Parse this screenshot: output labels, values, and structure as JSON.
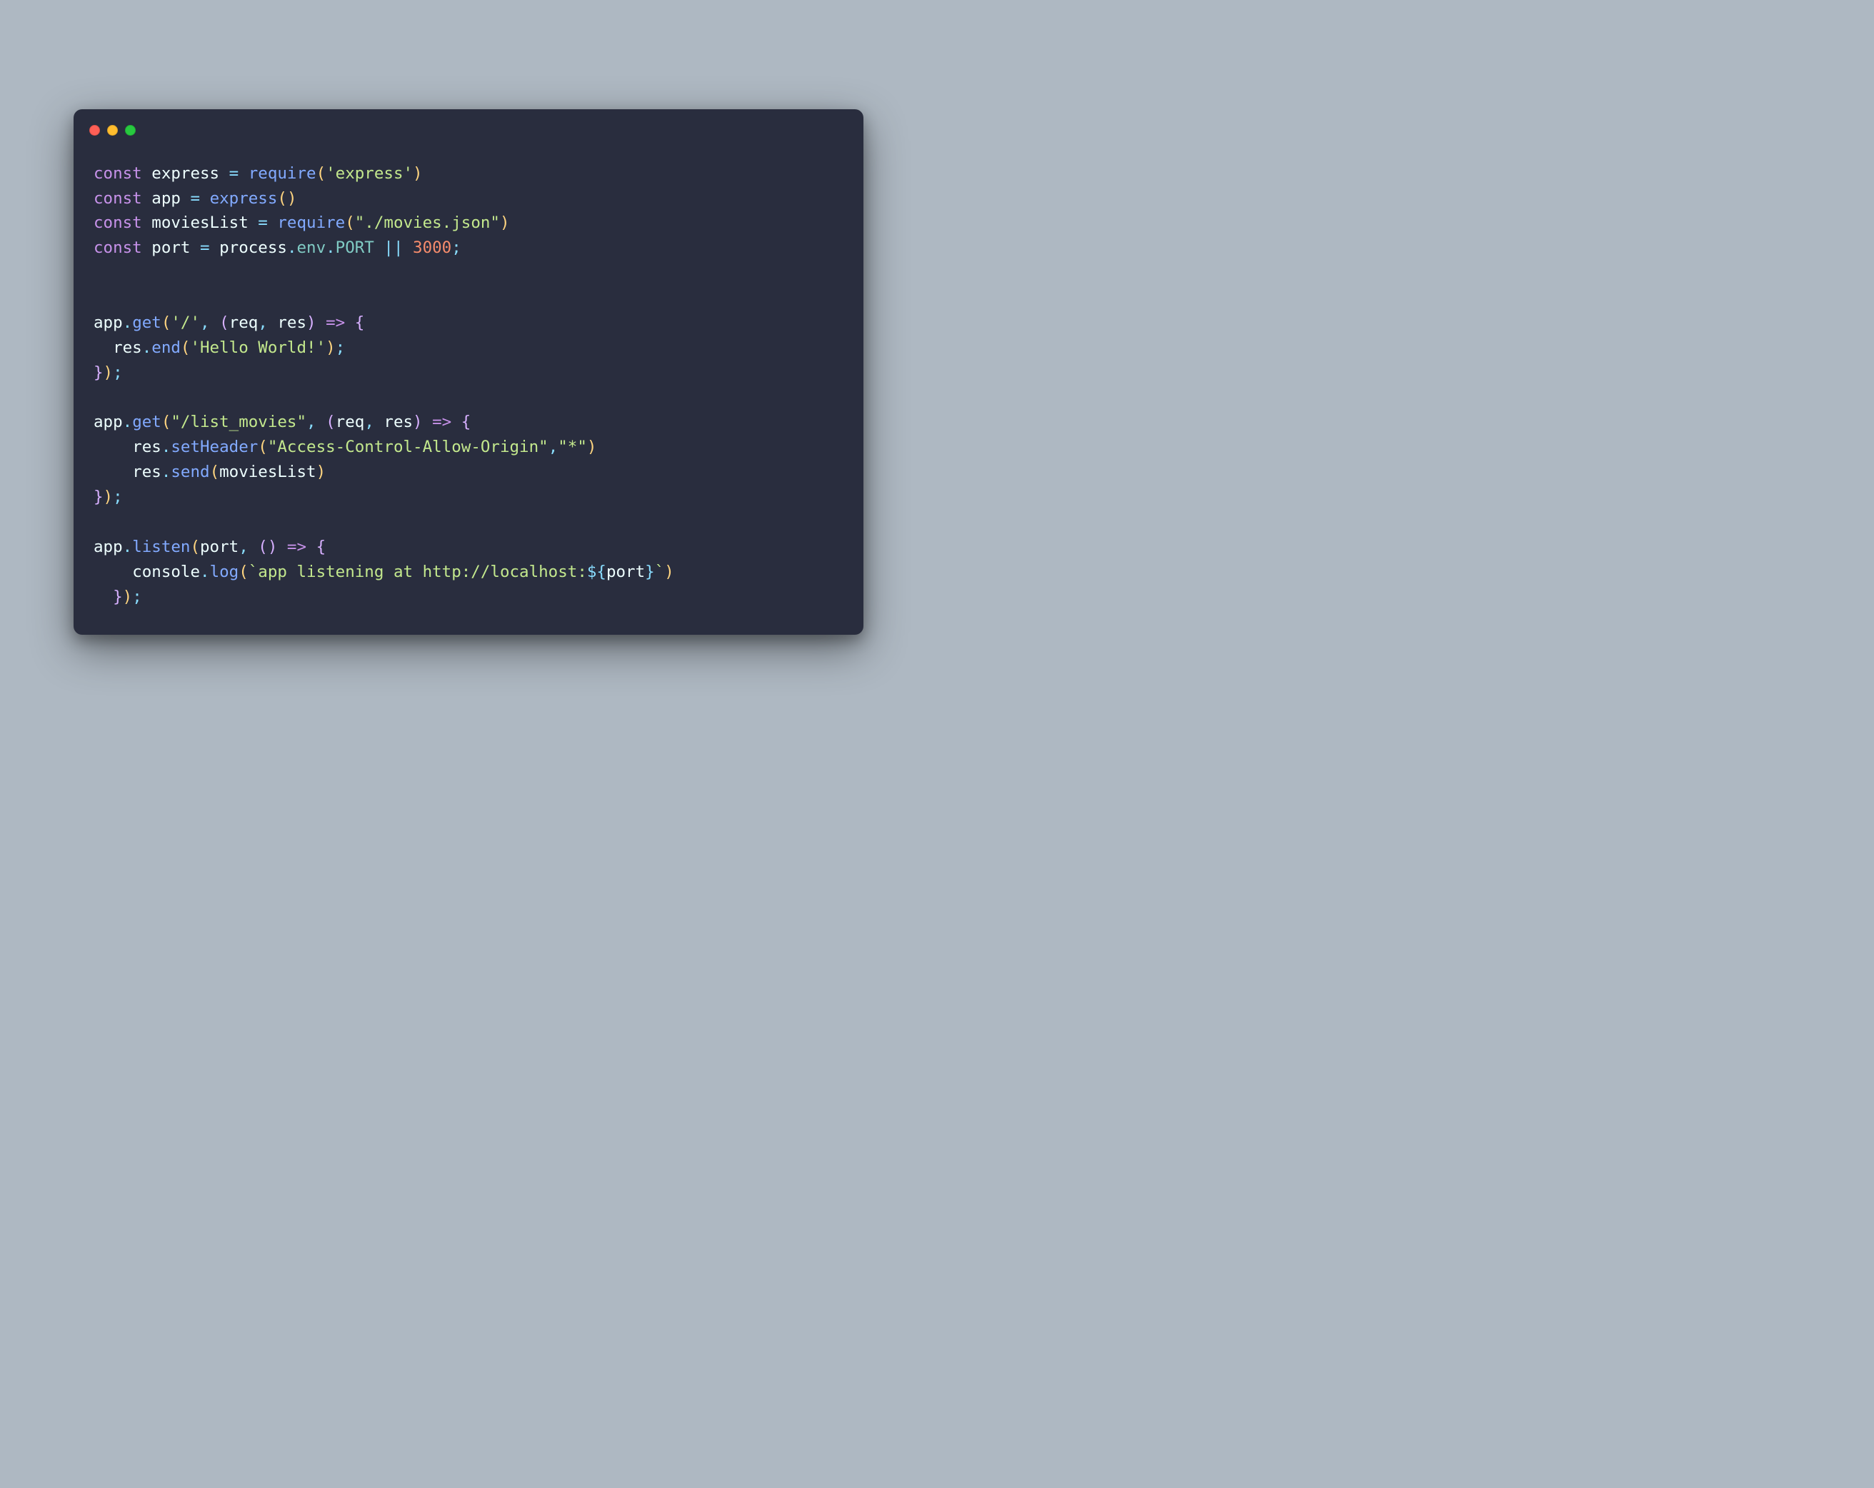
{
  "window": {
    "traffic_lights": [
      "close",
      "minimize",
      "zoom"
    ]
  },
  "code": {
    "l1": {
      "const": "const",
      "sp": " ",
      "id": "express",
      "eq": " = ",
      "fn": "require",
      "po": "(",
      "str": "'express'",
      "pc": ")"
    },
    "l2": {
      "const": "const",
      "sp": " ",
      "id": "app",
      "eq": " = ",
      "fn": "express",
      "po": "(",
      "pc": ")"
    },
    "l3": {
      "const": "const",
      "sp": " ",
      "id": "moviesList",
      "eq": " = ",
      "fn": "require",
      "po": "(",
      "str": "\"./movies.json\"",
      "pc": ")"
    },
    "l4": {
      "const": "const",
      "sp": " ",
      "id": "port",
      "eq": " = ",
      "p1": "process",
      "d1": ".",
      "p2": "env",
      "d2": ".",
      "p3": "PORT",
      "or": " || ",
      "num": "3000",
      "sc": ";"
    },
    "l7": {
      "app": "app",
      "d": ".",
      "fn": "get",
      "po": "(",
      "str": "'/'",
      "cm": ", ",
      "po2": "(",
      "a1": "req",
      "cm2": ", ",
      "a2": "res",
      "pc2": ")",
      "ar": " => ",
      "bo": "{"
    },
    "l8": {
      "ind": "  ",
      "res": "res",
      "d": ".",
      "fn": "end",
      "po": "(",
      "str": "'Hello World!'",
      "pc": ")",
      "sc": ";"
    },
    "l9": {
      "bc": "}",
      "pc": ")",
      "sc": ";"
    },
    "l11": {
      "app": "app",
      "d": ".",
      "fn": "get",
      "po": "(",
      "str": "\"/list_movies\"",
      "cm": ", ",
      "po2": "(",
      "a1": "req",
      "cm2": ", ",
      "a2": "res",
      "pc2": ")",
      "ar": " => ",
      "bo": "{"
    },
    "l12": {
      "ind": "    ",
      "res": "res",
      "d": ".",
      "fn": "setHeader",
      "po": "(",
      "s1": "\"Access-Control-Allow-Origin\"",
      "cm": ",",
      "s2": "\"*\"",
      "pc": ")"
    },
    "l13": {
      "ind": "    ",
      "res": "res",
      "d": ".",
      "fn": "send",
      "po": "(",
      "arg": "moviesList",
      "pc": ")"
    },
    "l14": {
      "bc": "}",
      "pc": ")",
      "sc": ";"
    },
    "l16": {
      "app": "app",
      "d": ".",
      "fn": "listen",
      "po": "(",
      "arg": "port",
      "cm": ", ",
      "po2": "(",
      "pc2": ")",
      "ar": " => ",
      "bo": "{"
    },
    "l17": {
      "ind": "    ",
      "con": "console",
      "d": ".",
      "fn": "log",
      "po": "(",
      "bt1": "`",
      "t1": "app listening at http://localhost:",
      "io": "${",
      "iv": "port",
      "ic": "}",
      "bt2": "`",
      "pc": ")"
    },
    "l18": {
      "ind": "  ",
      "bc": "}",
      "pc": ")",
      "sc": ";"
    }
  }
}
